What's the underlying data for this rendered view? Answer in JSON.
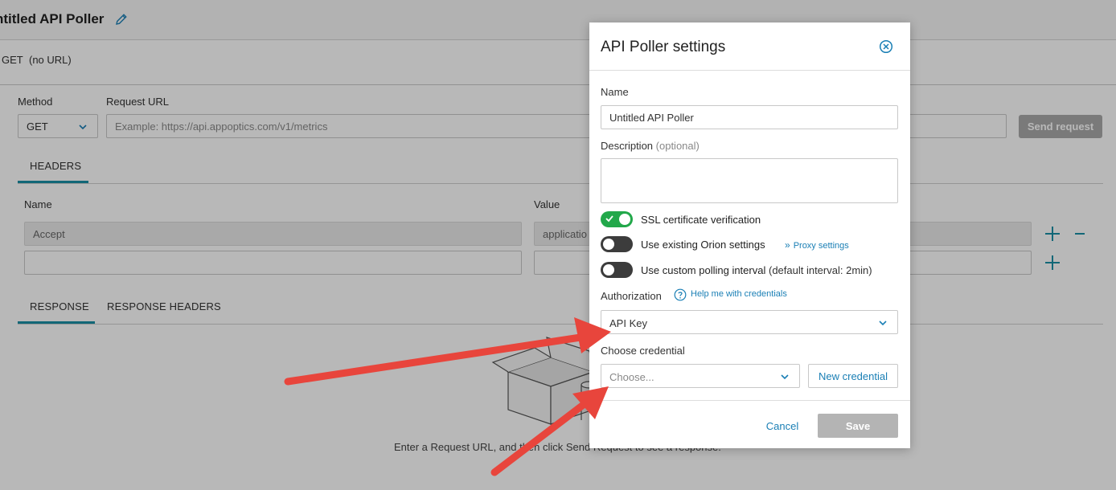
{
  "page": {
    "title": "ntitled API Poller",
    "summary_method": "GET",
    "summary_url": "(no URL)",
    "method_label": "Method",
    "method_value": "GET",
    "url_label": "Request URL",
    "url_placeholder": "Example: https://api.appoptics.com/v1/metrics",
    "send_label": "Send request",
    "tabs": [
      {
        "label": "HEADERS"
      }
    ],
    "headers_name_label": "Name",
    "headers_value_label": "Value",
    "header_rows": [
      {
        "name": "Accept",
        "value": "applicatio"
      },
      {
        "name": "",
        "value": ""
      }
    ],
    "response_tabs": [
      {
        "label": "RESPONSE"
      },
      {
        "label": "RESPONSE HEADERS"
      }
    ],
    "empty_text": "Enter a Request URL, and then click Send Request to see a response."
  },
  "modal": {
    "title": "API Poller settings",
    "name_label": "Name",
    "name_value": "Untitled API Poller",
    "description_label": "Description",
    "description_optional": "(optional)",
    "ssl_label": "SSL certificate verification",
    "orion_label": "Use existing Orion settings",
    "proxy_link": "Proxy settings",
    "interval_label": "Use custom polling interval",
    "interval_note": "(default interval: 2min)",
    "auth_label": "Authorization",
    "help_link": "Help me with credentials",
    "auth_value": "API Key",
    "credential_label": "Choose credential",
    "credential_placeholder": "Choose...",
    "new_credential": "New credential",
    "cancel": "Cancel",
    "save": "Save"
  },
  "colors": {
    "accent": "#1a8fa6",
    "link": "#1a7fb5",
    "toggle_on": "#22a84a",
    "toggle_off": "#3c3c3c",
    "arrow": "#e8453c"
  }
}
